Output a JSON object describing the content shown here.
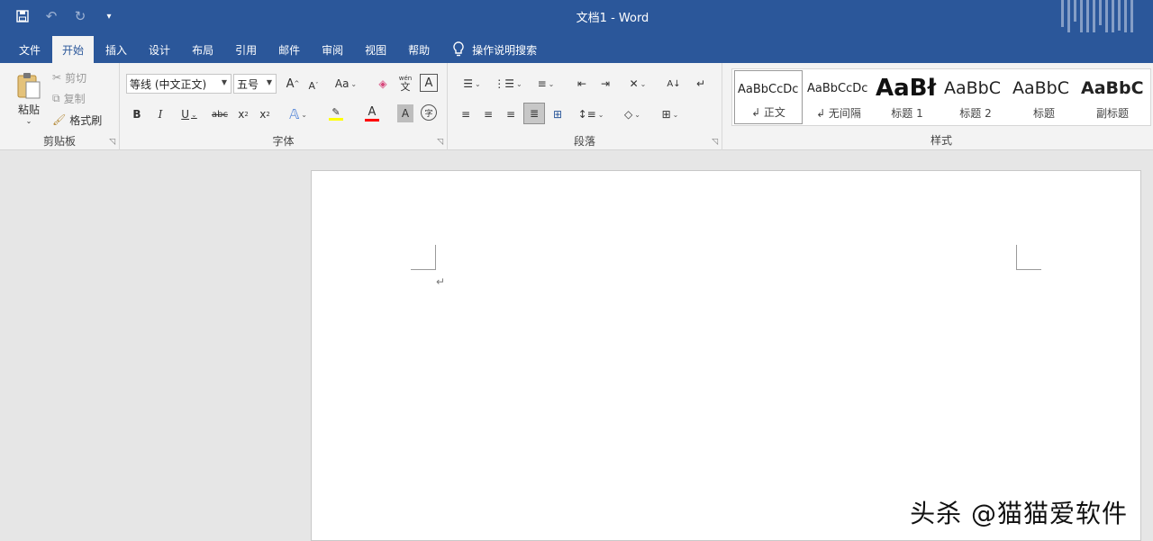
{
  "window": {
    "title": "文档1  -  Word"
  },
  "qat": {
    "undo": "↶",
    "redo": "↻",
    "customize": "▾"
  },
  "tabs": [
    "文件",
    "开始",
    "插入",
    "设计",
    "布局",
    "引用",
    "邮件",
    "审阅",
    "视图",
    "帮助"
  ],
  "active_tab": "开始",
  "tell_me": "操作说明搜索",
  "clipboard": {
    "label": "剪贴板",
    "paste": "粘贴",
    "cut": "剪切",
    "copy": "复制",
    "format_painter": "格式刷"
  },
  "font": {
    "label": "字体",
    "name": "等线 (中文正文)",
    "size": "五号",
    "bold": "B",
    "italic": "I",
    "underline": "U",
    "strikethrough": "abc",
    "grow": "A",
    "shrink": "A",
    "case": "Aa",
    "pinyin_top": "wén",
    "pinyin_bottom": "文",
    "border_char": "A",
    "font_color": "A",
    "shade": "A",
    "enclose": "字"
  },
  "paragraph": {
    "label": "段落"
  },
  "styles": {
    "label": "样式",
    "items": [
      {
        "preview": "AaBbCcDc",
        "name": "↲ 正文"
      },
      {
        "preview": "AaBbCcDc",
        "name": "↲ 无间隔"
      },
      {
        "preview": "AaBł",
        "name": "标题 1"
      },
      {
        "preview": "AaBbC",
        "name": "标题 2"
      },
      {
        "preview": "AaBbC",
        "name": "标题"
      },
      {
        "preview": "AaBbC",
        "name": "副标题"
      }
    ]
  },
  "document": {
    "paragraph_mark": "↵"
  },
  "watermark": "头杀 @猫猫爱软件",
  "colors": {
    "accent": "#2b579a",
    "highlight": "#ffff00",
    "font_color": "#ff0000"
  }
}
